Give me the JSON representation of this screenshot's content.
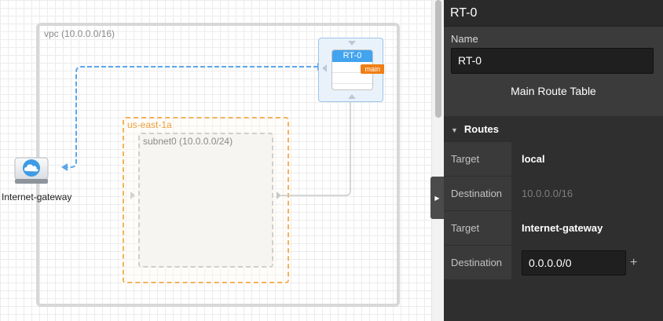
{
  "canvas": {
    "vpc_label": "vpc (10.0.0.0/16)",
    "az_label": "us-east-1a",
    "subnet_label": "subnet0 (10.0.0.0/24)",
    "route_table": {
      "title": "RT-0",
      "badge": "main"
    },
    "gateway_label": "Internet-gateway",
    "icons": {
      "gateway": "cloud-gateway-icon",
      "toggle": "chevron-right-icon"
    }
  },
  "panel": {
    "title": "RT-0",
    "name_label": "Name",
    "name_value": "RT-0",
    "main_route_table_label": "Main Route Table",
    "routes_header": "Routes",
    "routes": [
      {
        "target_key": "Target",
        "target": "local",
        "dest_key": "Destination",
        "destination": "10.0.0.0/16"
      },
      {
        "target_key": "Target",
        "target": "Internet-gateway",
        "dest_key": "Destination",
        "destination": "0.0.0.0/0"
      }
    ],
    "add_icon": "+"
  },
  "colors": {
    "accent_blue": "#42a3ef",
    "badge_orange": "#f07e14",
    "az_orange": "#f0b35a",
    "panel_bg": "#2f2f2f"
  }
}
